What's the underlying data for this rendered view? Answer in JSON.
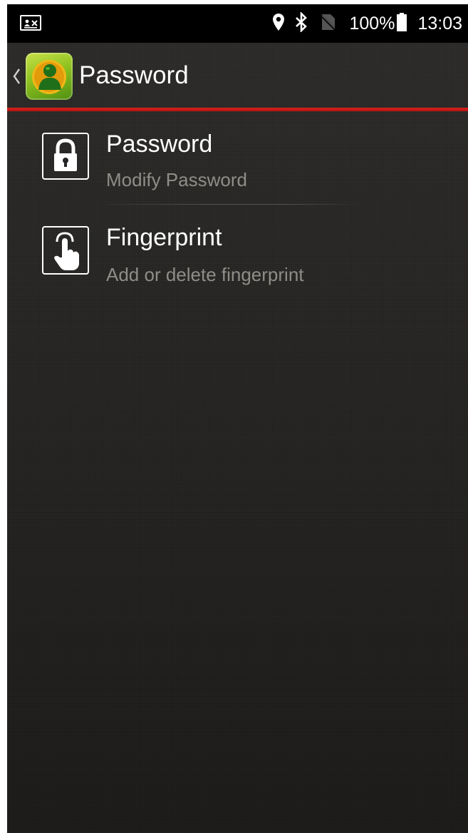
{
  "status_bar": {
    "notification_icon": "contact-card-icon",
    "location_icon": "location-pin-icon",
    "bluetooth_icon": "bluetooth-icon",
    "signal_icon": "no-sim-icon",
    "battery_level": "100%",
    "battery_icon": "battery-icon",
    "time": "13:03"
  },
  "action_bar": {
    "back_icon": "chevron-left-icon",
    "app_icon": "user-app-icon",
    "title": "Password"
  },
  "list": {
    "items": [
      {
        "icon": "lock-icon",
        "title": "Password",
        "subtitle": "Modify Password"
      },
      {
        "icon": "touch-hand-icon",
        "title": "Fingerprint",
        "subtitle": "Add or delete fingerprint"
      }
    ]
  },
  "colors": {
    "accent_divider": "#c8190f",
    "background": "#262523",
    "subtitle_text": "#8e8e88"
  }
}
